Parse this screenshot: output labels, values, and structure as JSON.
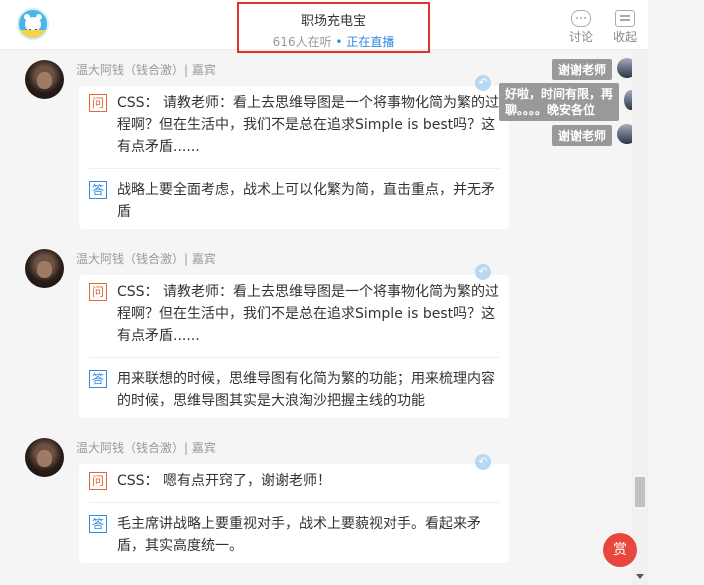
{
  "header": {
    "logo": "bear-logo",
    "title": "职场充电宝",
    "listeners": "616人在听",
    "dot": "•",
    "status": "正在直播",
    "discuss_label": "讨论",
    "collapse_label": "收起"
  },
  "messages": [
    {
      "author": "温大阿钱（钱合激）| 嘉宾",
      "q_tag": "问",
      "question": "CSS： 请教老师：看上去思维导图是一个将事物化简为繁的过程啊？但在生活中，我们不是总在追求Simple is best吗？这有点矛盾......",
      "a_tag": "答",
      "answer": "战略上要全面考虑，战术上可以化繁为简，直击重点，并无矛盾"
    },
    {
      "author": "温大阿钱（钱合激）| 嘉宾",
      "q_tag": "问",
      "question": "CSS： 请教老师：看上去思维导图是一个将事物化简为繁的过程啊？但在生活中，我们不是总在追求Simple is best吗？这有点矛盾......",
      "a_tag": "答",
      "answer": "用来联想的时候，思维导图有化简为繁的功能；用来梳理内容的时候，思维导图其实是大浪淘沙把握主线的功能"
    },
    {
      "author": "温大阿钱（钱合激）| 嘉宾",
      "q_tag": "问",
      "question": "CSS： 嗯有点开窍了，谢谢老师！",
      "a_tag": "答",
      "answer": "毛主席讲战略上要重视对手，战术上要藐视对手。看起来矛盾，其实高度统一。"
    }
  ],
  "chat": [
    {
      "text": "谢谢老师"
    },
    {
      "text": "好啦，时间有限，再聊。。。。晚安各位"
    },
    {
      "text": "谢谢老师"
    }
  ],
  "reward_label": "赏",
  "icons": {
    "share": "share-icon",
    "discuss": "chat-icon",
    "collapse": "doc-icon"
  }
}
